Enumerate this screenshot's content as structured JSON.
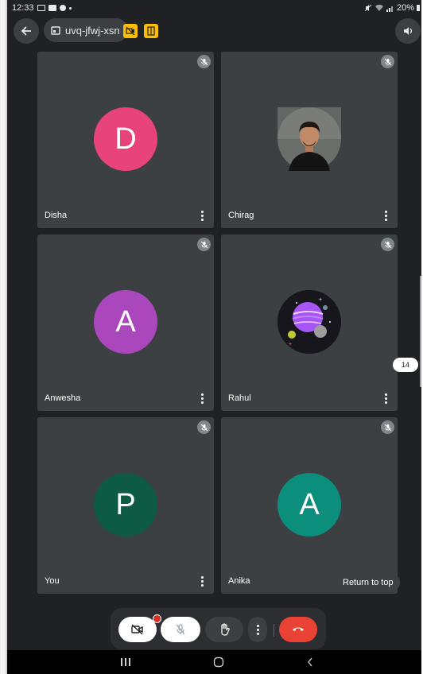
{
  "status_bar": {
    "time": "12:33",
    "battery": "20%"
  },
  "header": {
    "meeting_code": "uvq-jfwj-xsn"
  },
  "participants": [
    {
      "name": "Disha",
      "initial": "D",
      "avatar_color": "#e8437b",
      "type": "initial"
    },
    {
      "name": "Chirag",
      "initial": "",
      "avatar_color": "#2a2a2a",
      "type": "photo"
    },
    {
      "name": "Anwesha",
      "initial": "A",
      "avatar_color": "#ab47bc",
      "type": "initial"
    },
    {
      "name": "Rahul",
      "initial": "",
      "avatar_color": "#1a1a22",
      "type": "planet"
    },
    {
      "name": "You",
      "initial": "P",
      "avatar_color": "#0d5a45",
      "type": "initial"
    },
    {
      "name": "Anika",
      "initial": "A",
      "avatar_color": "#0c8e7c",
      "type": "initial"
    }
  ],
  "overflow_count": "14",
  "return_to_top": "Return to top",
  "controls": {
    "camera": "camera-off-icon",
    "microphone": "mic-off-icon",
    "raise_hand": "hand-icon",
    "more": "more-vert-icon",
    "end_call": "end-call-icon"
  },
  "colors": {
    "background": "#202124",
    "tile": "#3c4043",
    "end_call": "#ea4335",
    "badge": "#d93025",
    "yellow_chip": "#fbbc04"
  }
}
